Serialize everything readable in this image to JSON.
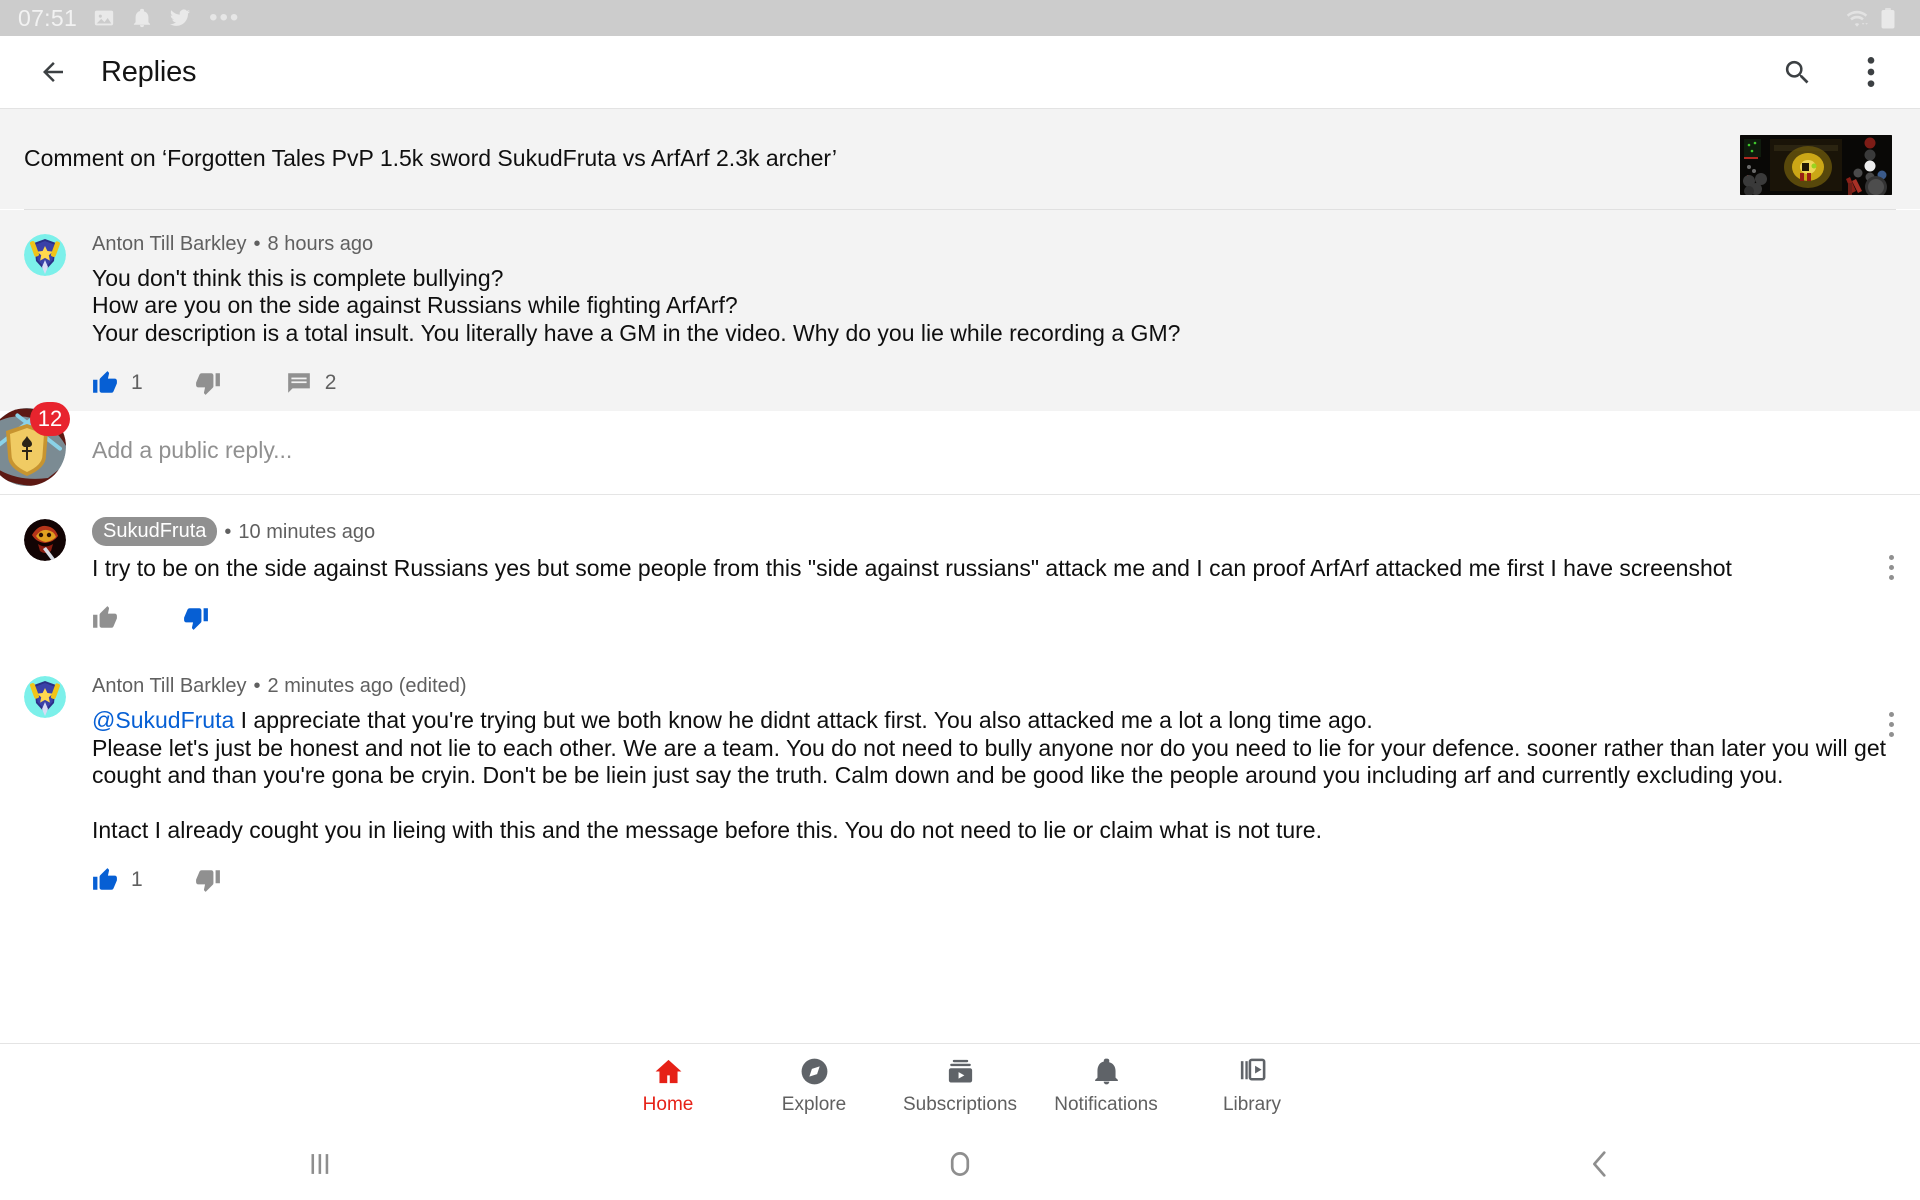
{
  "status_bar": {
    "time": "07:51",
    "left_icons": [
      "image-icon",
      "bell-icon",
      "twitter-icon",
      "more-icon"
    ],
    "right_icons": [
      "wifi-icon",
      "battery-icon"
    ]
  },
  "app_bar": {
    "back_icon": "back-arrow-icon",
    "title": "Replies",
    "search_icon": "search-icon",
    "overflow_icon": "more-vertical-icon"
  },
  "video_context": {
    "text": "Comment on ‘Forgotten Tales PvP 1.5k sword SukudFruta vs ArfArf 2.3k archer’",
    "thumbnail_alt": "video-thumbnail"
  },
  "parent_comment": {
    "author": "Anton Till Barkley",
    "separator": "•",
    "timestamp": "8 hours ago",
    "text": "You don't think this is complete bullying?\nHow are you on the side against Russians while fighting ArfArf?\nYour description is a total insult. You literally have a GM in the video. Why do you lie while recording a GM?",
    "like_count": "1",
    "dislike_count": "",
    "reply_count": "2",
    "liked": true,
    "disliked": false
  },
  "reply_composer": {
    "placeholder": "Add a public reply..."
  },
  "replies": [
    {
      "author": "SukudFruta",
      "author_is_badge": true,
      "separator": "•",
      "timestamp": "10 minutes ago",
      "text": "I try to be on the side against Russians yes but some people from this \"side against russians\" attack me and I can proof ArfArf attacked me first I have screenshot",
      "like_count": "",
      "dislike_count": "",
      "liked": false,
      "disliked": true
    },
    {
      "author": "Anton Till Barkley",
      "author_is_badge": false,
      "separator": "•",
      "timestamp": "2 minutes ago (edited)",
      "mention": "@SukudFruta",
      "text": " I appreciate that you're trying but we both know he didnt attack first. You also attacked me a lot a long time ago.\nPlease let's just be honest and not lie to each other. We are a team. You do not need to bully anyone nor do you need to lie for your defence. sooner rather than later you will get cought and than you're gona be cryin. Don't be be liein just say the truth. Calm down and be good like the people around you including arf and currently excluding you.\n\nIntact I already cought you in lieing with this and the message before this. You do not need to lie or claim what is not ture.",
      "like_count": "1",
      "dislike_count": "",
      "liked": true,
      "disliked": false
    }
  ],
  "chat_head": {
    "badge_count": "12",
    "icon": "shield-fleur-de-lis-icon"
  },
  "bottom_nav": {
    "items": [
      {
        "label": "Home",
        "icon": "home-icon",
        "active": true
      },
      {
        "label": "Explore",
        "icon": "compass-icon",
        "active": false
      },
      {
        "label": "Subscriptions",
        "icon": "subscriptions-icon",
        "active": false
      },
      {
        "label": "Notifications",
        "icon": "bell-icon",
        "active": false
      },
      {
        "label": "Library",
        "icon": "library-icon",
        "active": false
      }
    ]
  },
  "system_nav": {
    "recents": "recents-icon",
    "home": "home-circle-icon",
    "back": "back-chevron-icon"
  },
  "colors": {
    "accent_red": "#e62117",
    "link_blue": "#065fd4",
    "action_blue": "#065fd4",
    "badge_red": "#e8242e",
    "muted_text": "#606060",
    "surface_grey": "#f3f3f3"
  }
}
